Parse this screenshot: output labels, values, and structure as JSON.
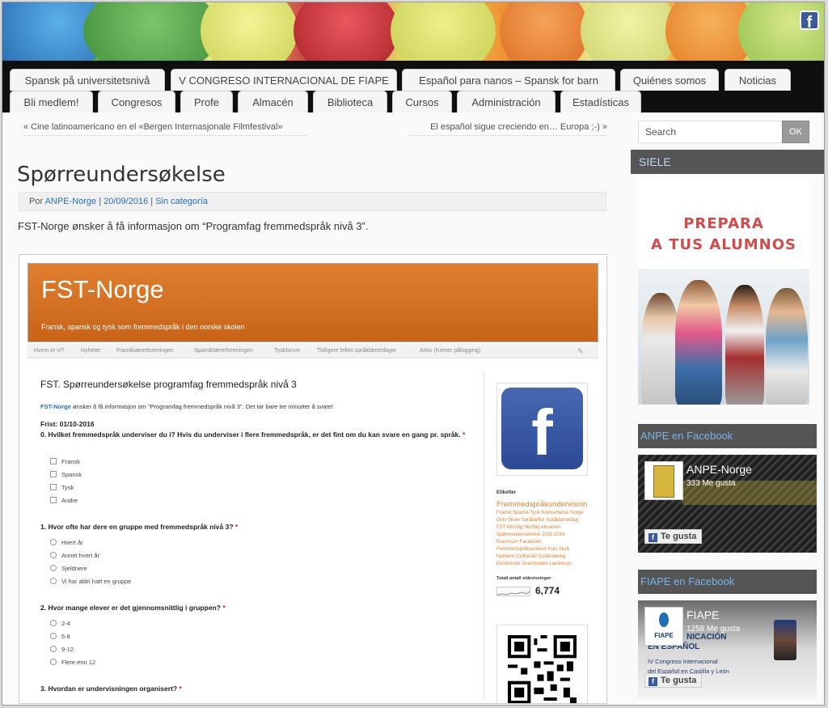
{
  "nav": {
    "row1": [
      "Spansk på universitetsnivå",
      "V CONGRESO INTERNACIONAL DE FIAPE",
      "Español para nanos – Spansk for barn",
      "Quiénes somos",
      "Noticias"
    ],
    "row2": [
      "Bli medlem!",
      "Congresos",
      "Profe",
      "Almacén",
      "Biblioteca",
      "Cursos",
      "Administración",
      "Estadísticas"
    ]
  },
  "post_nav": {
    "prev": "« Cine latinoamericano en el «Bergen Internasjonale Filmfestival»",
    "next": "El español sigue creciendo en… Europa ;-) »"
  },
  "post": {
    "title": "Spørreundersøkelse",
    "by": "Por",
    "author": "ANPE-Norge",
    "date": "20/09/2016",
    "category": "Sin categoría",
    "sep": "|",
    "intro": "FST-Norge ønsker å få informasjon om “Programfag fremmedspråk nivå 3”."
  },
  "embedded": {
    "site_title": "FST-Norge",
    "site_subtitle": "Fransk, spansk og tysk som fremmedspråk i den norske skolen",
    "nav": [
      "Hvem er vi?",
      "Nyheter",
      "Franskiærerforeningen",
      "Spansklærerforeningen",
      "Tyskforum",
      "Tidligere felles språklærerdager",
      "Arkiv (Krever pålogging)"
    ],
    "form_title": "FST. Spørreundersøkelse programfag fremmedspråk nivå 3",
    "form_intro_strong": "FST-Norge",
    "form_intro_rest": "ønsker å få informasjon om \"Programfag fremmedspråk nivå 3\". Det tar bare tre minutter å svare!",
    "deadline": "Frist: 01/10-2016",
    "required_mark": "*",
    "q0": "0. Hvilket fremmedspråk underviser du i? Hvis du underviser i flere fremmedspråk, er det fint om du kan svare en gang pr. språk.",
    "q0_options": [
      "Fransk",
      "Spansk",
      "Tysk",
      "Andre"
    ],
    "q1": "1. Hvor ofte har dere en gruppe med fremmedspråk nivå 3?",
    "q1_options": [
      "Hvert år",
      "Annet hvert år",
      "Sjeldnere",
      "Vi har aldri hatt en gruppe"
    ],
    "q2": "2. Hvor mange elever er det gjennomsnittlig i gruppen?",
    "q2_options": [
      "2-4",
      "5-8",
      "9-12",
      "Flere enn 12"
    ],
    "q3": "3. Hvordan er undervisningen organisert?",
    "etiketter_label": "Etiketter",
    "tags_big": "Fremmedspråkundervisning",
    "tags_rest": "Fransk Spansk Tysk Konkurranse Norge Oslo Skole Språkløftet Språklærerdag FST Muntlig Skriftlig eksamen Spørreundersøkelse 2015 2014 Erasmus+ Facebook Fremmedspråksenteret Kurs Nivå Nettverk Ordforråd Språkrøkting Elevtekster Grammatikk Lærerkurs Vurdering Samtale Litteratur Tekst",
    "stats_label": "Totalt antall sidevisninger",
    "stats_value": "6,774"
  },
  "sidebar": {
    "search_placeholder": "Search",
    "search_button": "OK",
    "siele_heading": "SIELE",
    "ad_line1": "PREPARA",
    "ad_line2": "A TUS ALUMNOS",
    "anpe_heading": "ANPE en Facebook",
    "anpe_name": "ANPE-Norge",
    "anpe_likes": "333 Me gusta",
    "like_button": "Te gusta",
    "fiape_heading": "FIAPE en Facebook",
    "fiape_name": "FIAPE",
    "fiape_likes": "1258 Me gusta",
    "fiape_thumb_label": "FIAPE",
    "fiape_bg_line1": "NICACIÓN",
    "fiape_bg_line2": "EN ESPAÑOL",
    "fiape_bg_line3": "IV Congreso Internacional",
    "fiape_bg_line4": "del Español en Castilla y León"
  },
  "colors": {
    "accent_orange": "#e07f2f",
    "link_blue": "#2a6fb5",
    "facebook_blue": "#3b5998",
    "sidebar_heading_bg": "#555555"
  },
  "icons": [
    "facebook-icon",
    "facebook-logo-icon",
    "qr-code-icon",
    "wrench-icon"
  ]
}
